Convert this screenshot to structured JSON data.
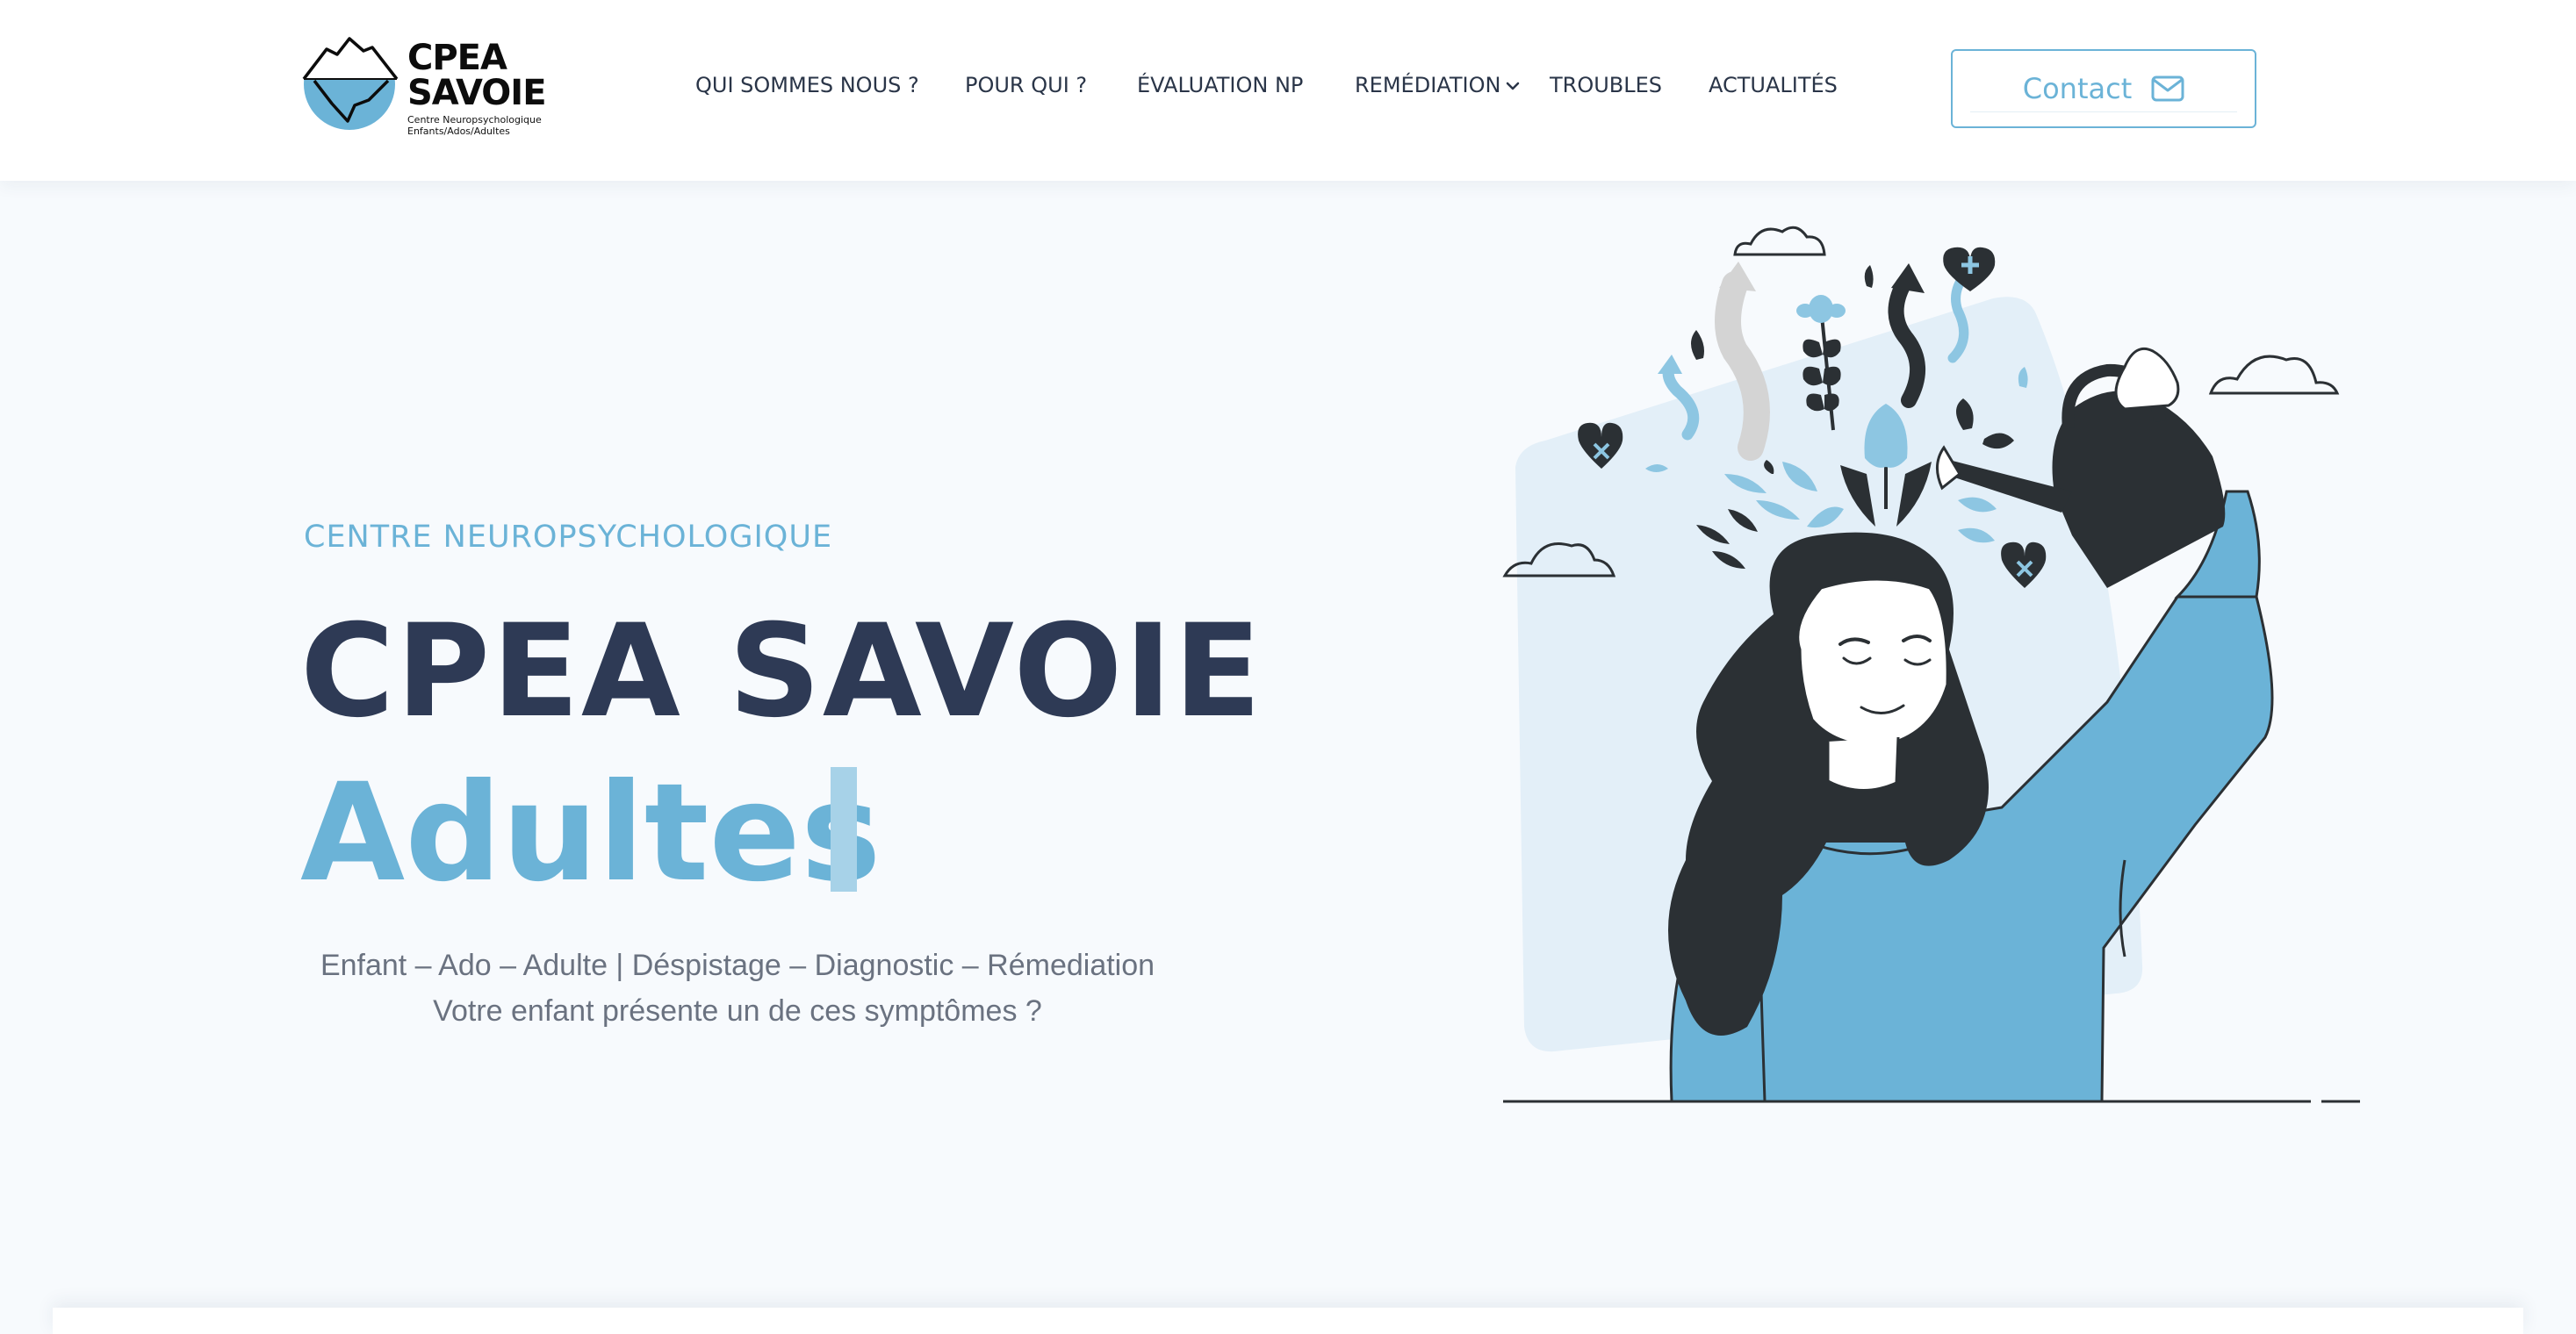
{
  "brand": {
    "logo_title": "CPEA SAVOIE",
    "logo_line1": "Centre Neuropsychologique",
    "logo_line2": "Enfants/Ados/Adultes"
  },
  "nav": {
    "items": [
      {
        "label": "QUI SOMMES NOUS ?"
      },
      {
        "label": "POUR QUI ?"
      },
      {
        "label": "ÉVALUATION NP"
      },
      {
        "label": "REMÉDIATION"
      },
      {
        "label": "TROUBLES"
      },
      {
        "label": "ACTUALITÉS"
      }
    ],
    "contact_label": "Contact"
  },
  "hero": {
    "eyebrow": "CENTRE NEUROPSYCHOLOGIQUE",
    "title": "CPEA SAVOIE",
    "typed_word": "Adultes",
    "subtitle_line1": "Enfant – Ado – Adulte | Déspistage – Diagnostic – Rémediation",
    "subtitle_line2": "Votre enfant présente un de ces symptômes ?"
  },
  "colors": {
    "accent": "#6bb3d7",
    "dark": "#2e3a55",
    "illustration_dark": "#2b3034",
    "background": "#f7fafd"
  },
  "icons": [
    "mail-icon",
    "chevron-down-icon",
    "logo-iceberg-icon"
  ]
}
